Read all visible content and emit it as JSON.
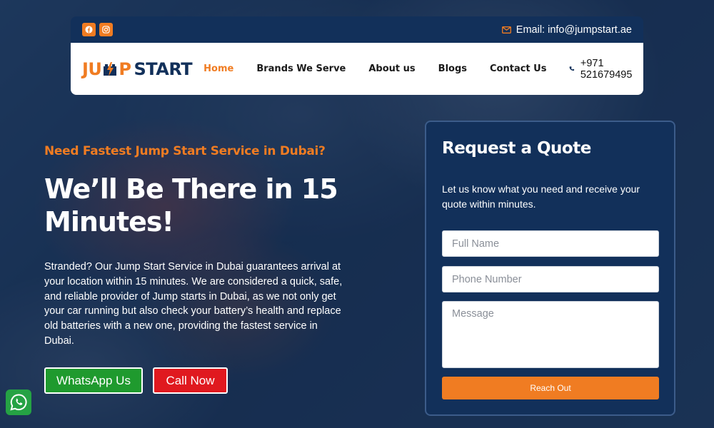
{
  "topbar": {
    "socials": [
      {
        "icon": "facebook-icon"
      },
      {
        "icon": "instagram-icon"
      }
    ],
    "email_text": "Email: info@jumpstart.ae"
  },
  "navbar": {
    "logo": {
      "part1": "JU",
      "part2": "P",
      "part3": "START"
    },
    "links": [
      {
        "label": "Home",
        "active": true
      },
      {
        "label": "Brands We Serve",
        "active": false
      },
      {
        "label": "About us",
        "active": false
      },
      {
        "label": "Blogs",
        "active": false
      },
      {
        "label": "Contact Us",
        "active": false
      }
    ],
    "phone": "+971 521679495"
  },
  "hero": {
    "eyebrow": "Need Fastest Jump Start Service in Dubai?",
    "title": "We’ll Be There in 15 Minutes!",
    "description": "Stranded? Our Jump Start Service in Dubai guarantees arrival at your location within 15 minutes. We are considered a quick, safe, and reliable provider of Jump starts in Dubai, as we not only get your car running but also check your battery’s health and replace old batteries with a new one, providing the fastest service in Dubai.",
    "whatsapp_label": "WhatsApp Us",
    "call_label": "Call Now"
  },
  "quote": {
    "title": "Request a Quote",
    "description": "Let us know what you need and receive your quote within minutes.",
    "name_placeholder": "Full Name",
    "phone_placeholder": "Phone Number",
    "message_placeholder": "Message",
    "submit_label": "Reach Out"
  },
  "colors": {
    "brand_orange": "#f07c22",
    "navy": "#12305a",
    "whatsapp_green": "#1f9a2e",
    "call_red": "#e0191f"
  }
}
